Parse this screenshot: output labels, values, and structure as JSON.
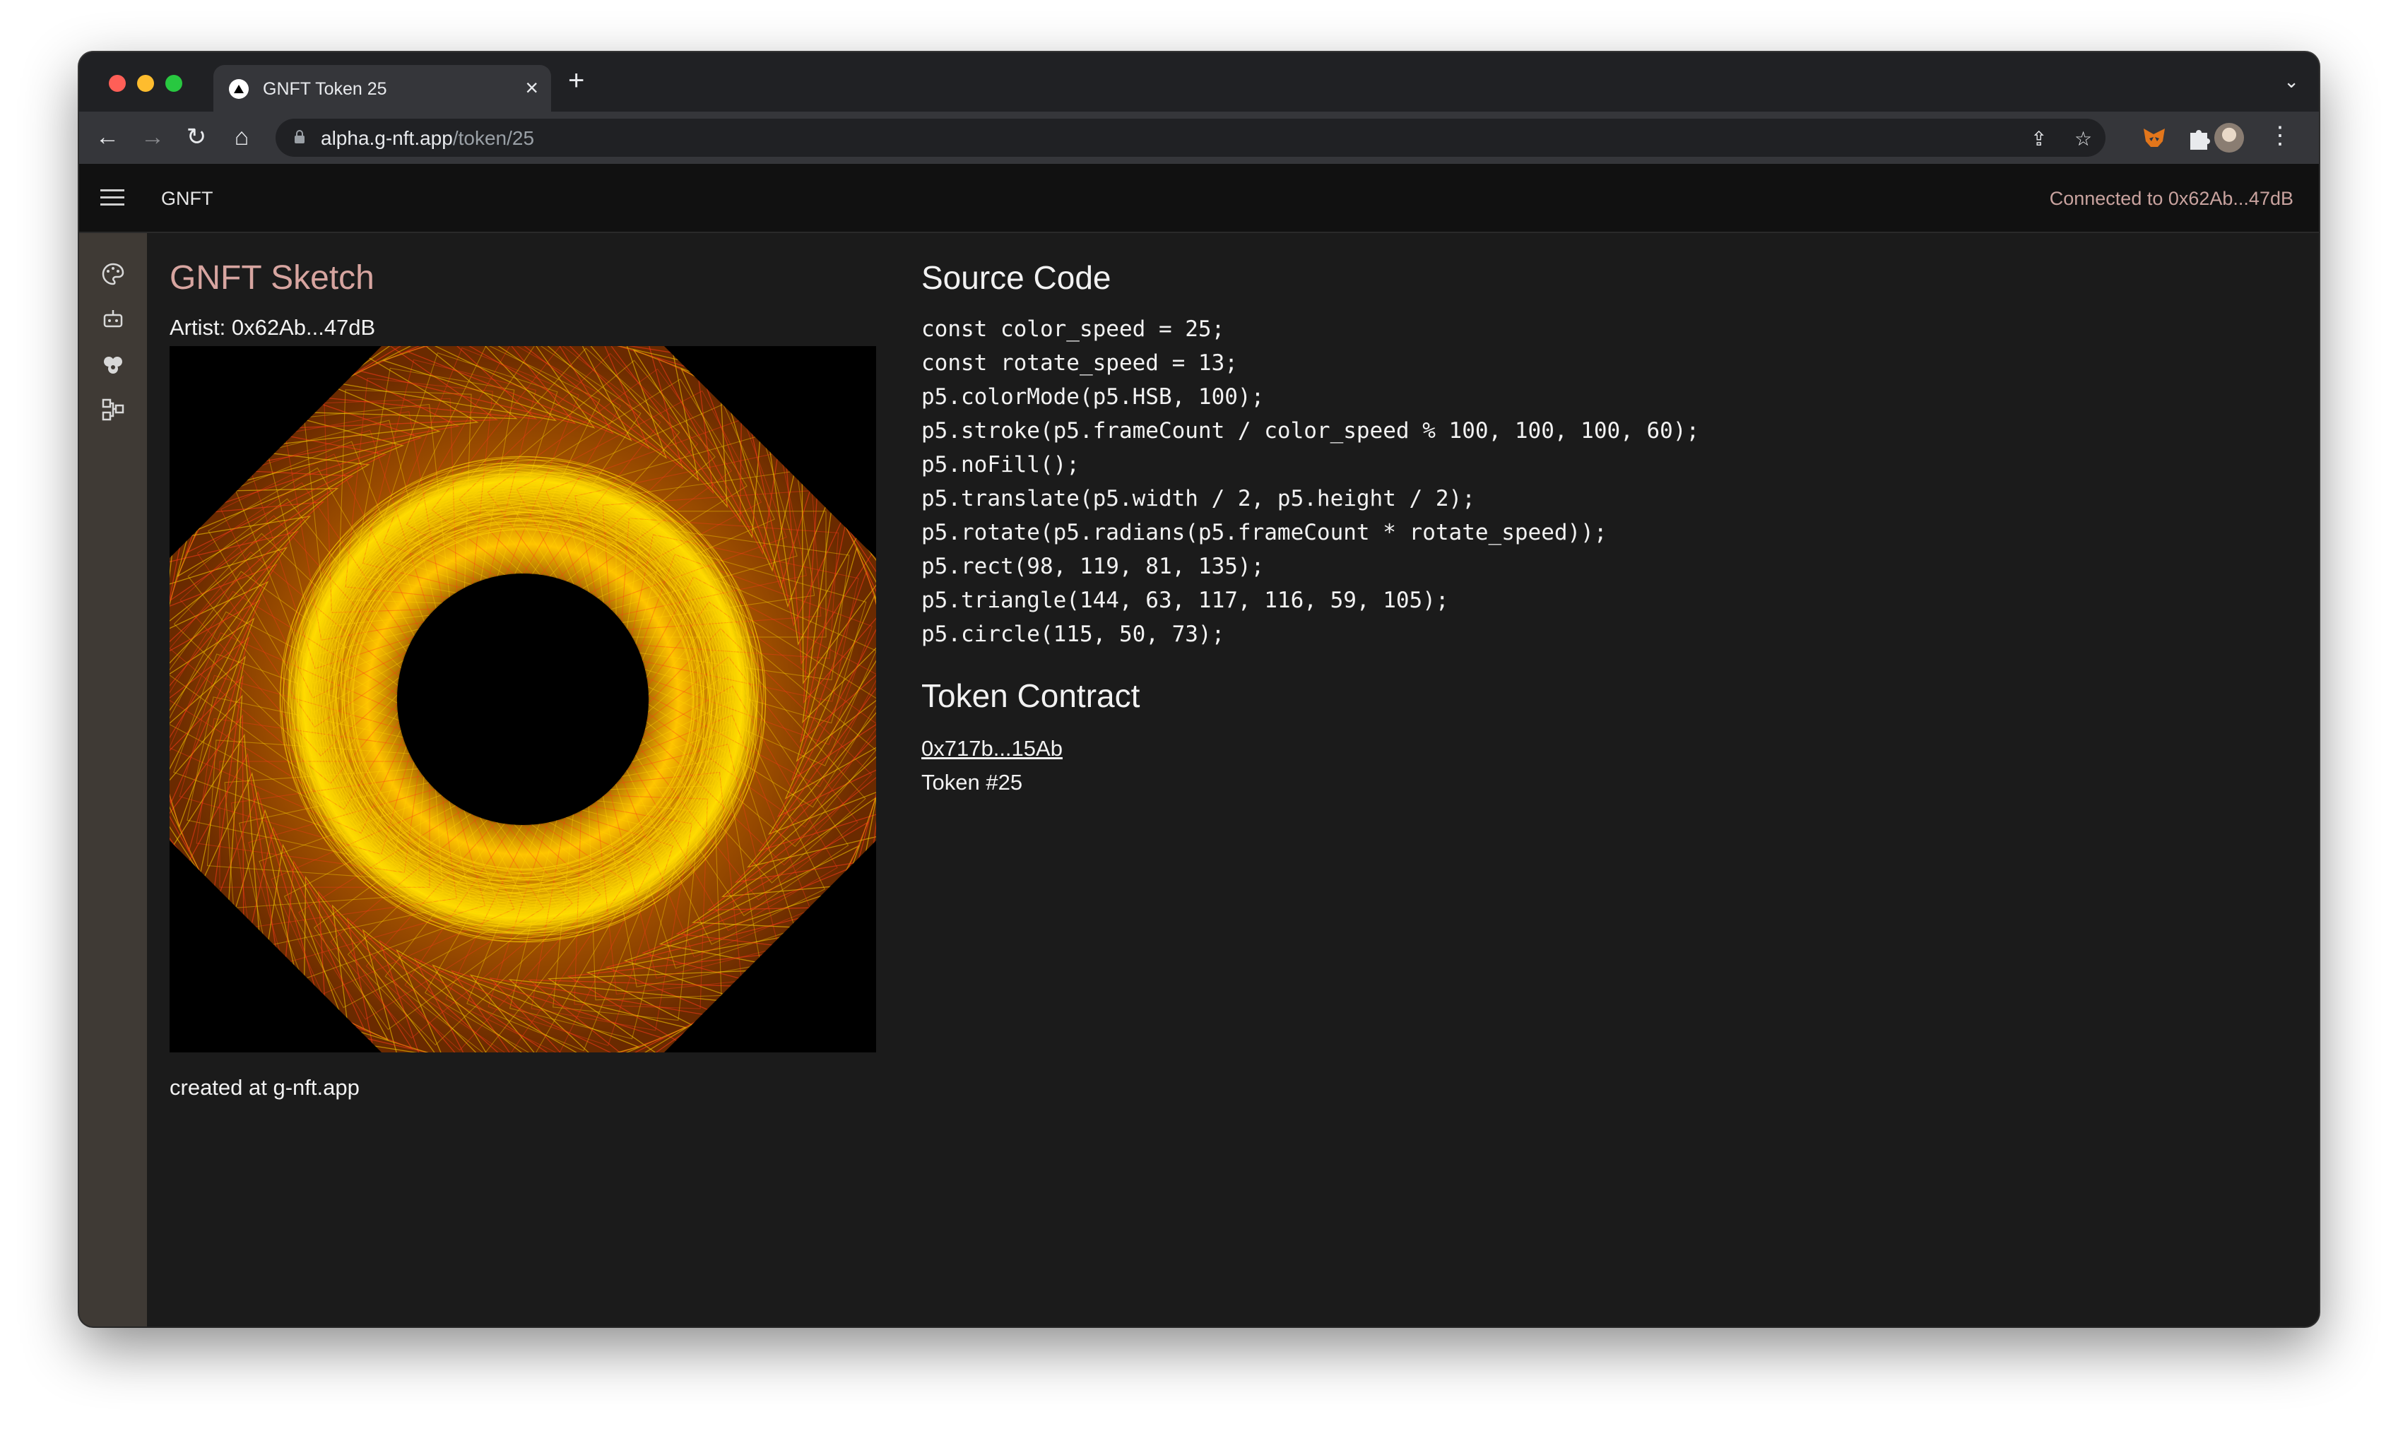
{
  "browser": {
    "tab_title": "GNFT Token 25",
    "tab_close": "×",
    "new_tab": "+",
    "tab_menu": "⌄",
    "url_host": "alpha.g-nft.app",
    "url_path": "/token/25"
  },
  "app": {
    "name": "GNFT",
    "connected": "Connected to 0x62Ab...47dB"
  },
  "sidebar": {
    "items": [
      "palette-icon",
      "robot-icon",
      "users-icon",
      "hierarchy-icon"
    ]
  },
  "sketch": {
    "title": "GNFT Sketch",
    "artist": "Artist: 0x62Ab...47dB",
    "footer": "created at g-nft.app"
  },
  "source": {
    "heading": "Source Code",
    "lines": [
      "const color_speed = 25;",
      "const rotate_speed = 13;",
      "p5.colorMode(p5.HSB, 100);",
      "p5.stroke(p5.frameCount / color_speed % 100, 100, 100, 60);",
      "p5.noFill();",
      "p5.translate(p5.width / 2, p5.height / 2);",
      "p5.rotate(p5.radians(p5.frameCount * rotate_speed));",
      "p5.rect(98, 119, 81, 135);",
      "p5.triangle(144, 63, 117, 116, 59, 105);",
      "p5.circle(115, 50, 73);"
    ]
  },
  "contract": {
    "heading": "Token Contract",
    "address": "0x717b...15Ab",
    "token": "Token #25"
  },
  "colors": {
    "accent_title": "#d7a5a0",
    "connected_text": "#c9a39f",
    "sketch_primary": "#ffd400",
    "sketch_secondary": "#ff3a1a"
  }
}
